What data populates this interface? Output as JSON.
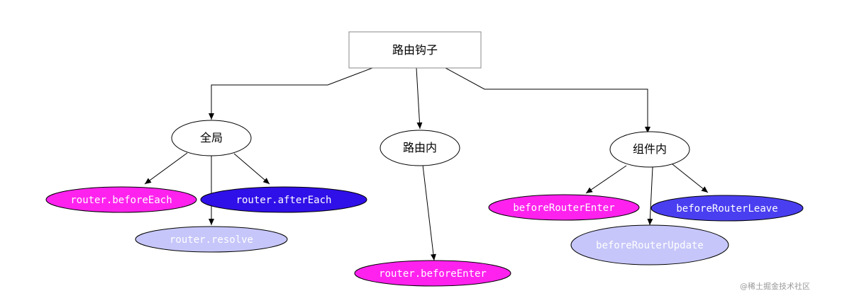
{
  "root": {
    "label": "路由钩子"
  },
  "groups": {
    "global": {
      "label": "全局"
    },
    "route": {
      "label": "路由内"
    },
    "component": {
      "label": "组件内"
    }
  },
  "hooks": {
    "before_each": {
      "label": "router.beforeEach",
      "fill": "#ff22ee",
      "text_color": "#ffffff"
    },
    "after_each": {
      "label": "router.afterEach",
      "fill": "#3010e8",
      "text_color": "#ffffff"
    },
    "resolve": {
      "label": "router.resolve",
      "fill": "#c6c6fa",
      "text_color": "#ffffff"
    },
    "before_enter": {
      "label": "router.beforeEnter",
      "fill": "#ff22ee",
      "text_color": "#ffffff"
    },
    "before_router_enter": {
      "label": "beforeRouterEnter",
      "fill": "#ff22ee",
      "text_color": "#ffffff"
    },
    "before_router_leave": {
      "label": "beforeRouterLeave",
      "fill": "#4a3ff0",
      "text_color": "#ffffff"
    },
    "before_router_update": {
      "label": "beforeRouterUpdate",
      "fill": "#c6c6fa",
      "text_color": "#ffffff"
    }
  },
  "watermark": "@稀土掘金技术社区",
  "colors": {
    "line": "#000000",
    "node_stroke": "#000000",
    "root_stroke": "#888888",
    "node_fill": "#ffffff"
  }
}
